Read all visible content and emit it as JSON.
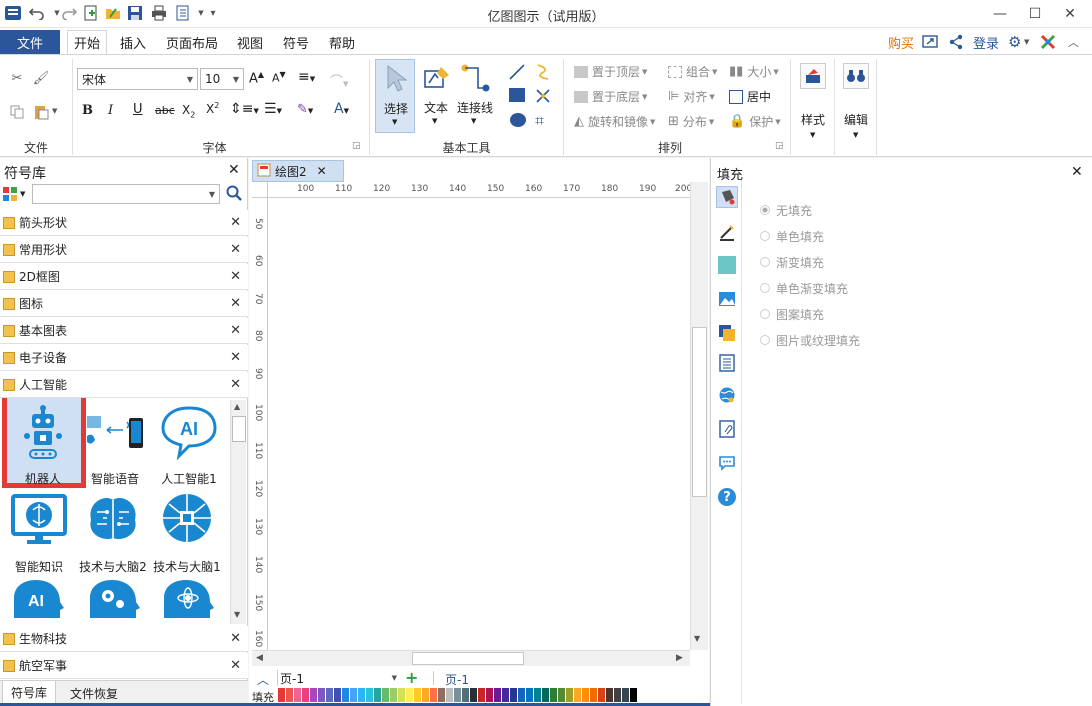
{
  "window": {
    "title": "亿图图示（试用版）"
  },
  "menu": {
    "file": "文件",
    "tabs": [
      "开始",
      "插入",
      "页面布局",
      "视图",
      "符号",
      "帮助"
    ],
    "active": "开始",
    "buy": "购买",
    "login": "登录"
  },
  "ribbon": {
    "groups": {
      "file": "文件",
      "font": "字体",
      "basic_tools": "基本工具",
      "arrange": "排列"
    },
    "font_name": "宋体",
    "font_size": "10",
    "tools": {
      "select": "选择",
      "text": "文本",
      "connector": "连接线"
    },
    "arrange": {
      "bring_top": "置于顶层",
      "send_bottom": "置于底层",
      "rotate_mirror": "旋转和镜像",
      "group": "组合",
      "align": "对齐",
      "distribute": "分布",
      "size": "大小",
      "center": "居中",
      "protect": "保护"
    },
    "style": "样式",
    "edit": "编辑"
  },
  "library": {
    "title": "符号库",
    "categories_top": [
      "箭头形状",
      "常用形状",
      "2D框图",
      "图标",
      "基本图表",
      "电子设备",
      "人工智能"
    ],
    "symbols": [
      "机器人",
      "智能语音",
      "人工智能1",
      "智能知识",
      "技术与大脑2",
      "技术与大脑1"
    ],
    "categories_bottom": [
      "生物科技",
      "航空军事"
    ],
    "tabs": [
      "符号库",
      "文件恢复"
    ]
  },
  "document": {
    "tab": "绘图2",
    "hruler": [
      "100",
      "110",
      "120",
      "130",
      "140",
      "150",
      "160",
      "170",
      "180",
      "190",
      "200"
    ],
    "vruler": [
      "50",
      "60",
      "70",
      "80",
      "90",
      "100",
      "110",
      "120",
      "130",
      "140",
      "150",
      "160"
    ],
    "page_select": "页-1",
    "page_tab": "页-1",
    "fill_label": "填充"
  },
  "fill_panel": {
    "title": "填充",
    "options": [
      "无填充",
      "单色填充",
      "渐变填充",
      "单色渐变填充",
      "图案填充",
      "图片或纹理填充"
    ],
    "selected": "无填充"
  },
  "palette": [
    "#e53935",
    "#ef5350",
    "#f06292",
    "#ec407a",
    "#ab47bc",
    "#7e57c2",
    "#5c6bc0",
    "#3f51b5",
    "#1e88e5",
    "#42a5f5",
    "#29b6f6",
    "#26c6da",
    "#26a69a",
    "#66bb6a",
    "#9ccc65",
    "#d4e157",
    "#ffee58",
    "#ffca28",
    "#ffa726",
    "#ff7043",
    "#8d6e63",
    "#bdbdbd",
    "#78909c",
    "#546e7a",
    "#263238",
    "#c62828",
    "#ad1457",
    "#6a1b9a",
    "#4527a0",
    "#283593",
    "#1565c0",
    "#0277bd",
    "#00838f",
    "#00695c",
    "#2e7d32",
    "#558b2f",
    "#9e9d24",
    "#f9a825",
    "#ff8f00",
    "#ef6c00",
    "#d84315",
    "#4e342e",
    "#424242",
    "#37474f",
    "#000000"
  ]
}
